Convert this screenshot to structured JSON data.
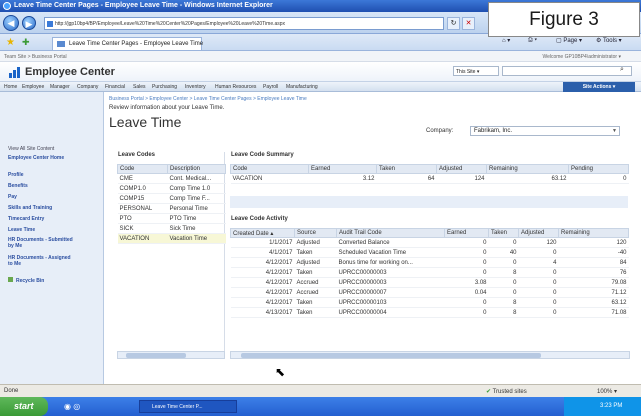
{
  "window": {
    "title": "Leave Time Center Pages - Employee Leave Time - Windows Internet Explorer"
  },
  "figure_label": "Figure 3",
  "browser": {
    "url": "http://jgp10bp4/BP/Employee/Leave%20Time%20Center%20Pages/Employee%20Leave%20Time.aspx",
    "tab": "Leave Time Center Pages - Employee Leave Time",
    "cmd_page": "Page",
    "cmd_tools": "Tools"
  },
  "portal": {
    "top_breadcrumb": "Team Site > Business Portal",
    "welcome": "Welcome GP10BP4\\administrator ▾",
    "site_name": "Employee Center",
    "this_site": "This Site",
    "site_actions": "Site Actions ▾"
  },
  "topnav": [
    "Home",
    "Employee",
    "Manager",
    "Company",
    "Financial",
    "Sales",
    "Purchasing",
    "Inventory",
    "Human Resources",
    "Payroll",
    "Manufacturing"
  ],
  "sidebar": {
    "view_all": "View All Site Content",
    "items": [
      "Employee Center Home",
      "Profile",
      "Benefits",
      "Pay",
      "Skills and Training",
      "Timecard Entry",
      "Leave Time",
      "HR Documents - Submitted by Me",
      "HR Documents - Assigned to Me"
    ],
    "recycle": "Recycle Bin"
  },
  "main": {
    "breadcrumb": "Business Portal > Employee Center > Leave Time Center Pages > Employee Leave Time",
    "subtitle": "Review information about your Leave Time.",
    "title": "Leave Time",
    "company_label": "Company:",
    "company_value": "Fabrikam, Inc."
  },
  "leave_codes": {
    "title": "Leave Codes",
    "headers": [
      "Code",
      "Description"
    ],
    "rows": [
      [
        "CME",
        "Cont. Medical..."
      ],
      [
        "COMP1.0",
        "Comp Time 1.0"
      ],
      [
        "COMP15",
        "Comp Time F..."
      ],
      [
        "PERSONAL",
        "Personal Time"
      ],
      [
        "PTO",
        "PTO Time"
      ],
      [
        "SICK",
        "Sick Time"
      ],
      [
        "VACATION",
        "Vacation Time"
      ]
    ]
  },
  "summary": {
    "title": "Leave Code Summary",
    "headers": [
      "Code",
      "Earned",
      "Taken",
      "Adjusted",
      "Remaining",
      "Pending"
    ],
    "rows": [
      [
        "VACATION",
        "3.12",
        "64",
        "124",
        "63.12",
        "0"
      ]
    ]
  },
  "activity": {
    "title": "Leave Code Activity",
    "headers": [
      "Created Date ▴",
      "Source",
      "Audit Trail Code",
      "Earned",
      "Taken",
      "Adjusted",
      "Remaining"
    ],
    "rows": [
      [
        "1/1/2017",
        "Adjusted",
        "Converted Balance",
        "0",
        "0",
        "120",
        "120"
      ],
      [
        "4/1/2017",
        "Taken",
        "Scheduled Vacation Time",
        "0",
        "40",
        "0",
        "-40"
      ],
      [
        "4/12/2017",
        "Adjusted",
        "Bonus time for working on...",
        "0",
        "0",
        "4",
        "84"
      ],
      [
        "4/12/2017",
        "Taken",
        "UPRCC00000003",
        "0",
        "8",
        "0",
        "76"
      ],
      [
        "4/12/2017",
        "Accrued",
        "UPRCC00000003",
        "3.08",
        "0",
        "0",
        "79.08"
      ],
      [
        "4/12/2017",
        "Accrued",
        "UPRCC00000007",
        "0.04",
        "0",
        "0",
        "71.12"
      ],
      [
        "4/12/2017",
        "Taken",
        "UPRCC00000103",
        "0",
        "8",
        "0",
        "63.12"
      ],
      [
        "4/13/2017",
        "Taken",
        "UPRCC00000004",
        "0",
        "8",
        "0",
        "71.08"
      ]
    ]
  },
  "status": {
    "left": "Done",
    "trusted": "Trusted sites",
    "zoom": "100%"
  },
  "taskbar": {
    "start": "start",
    "task": "Leave Time Center P...",
    "clock": "3:23 PM"
  }
}
